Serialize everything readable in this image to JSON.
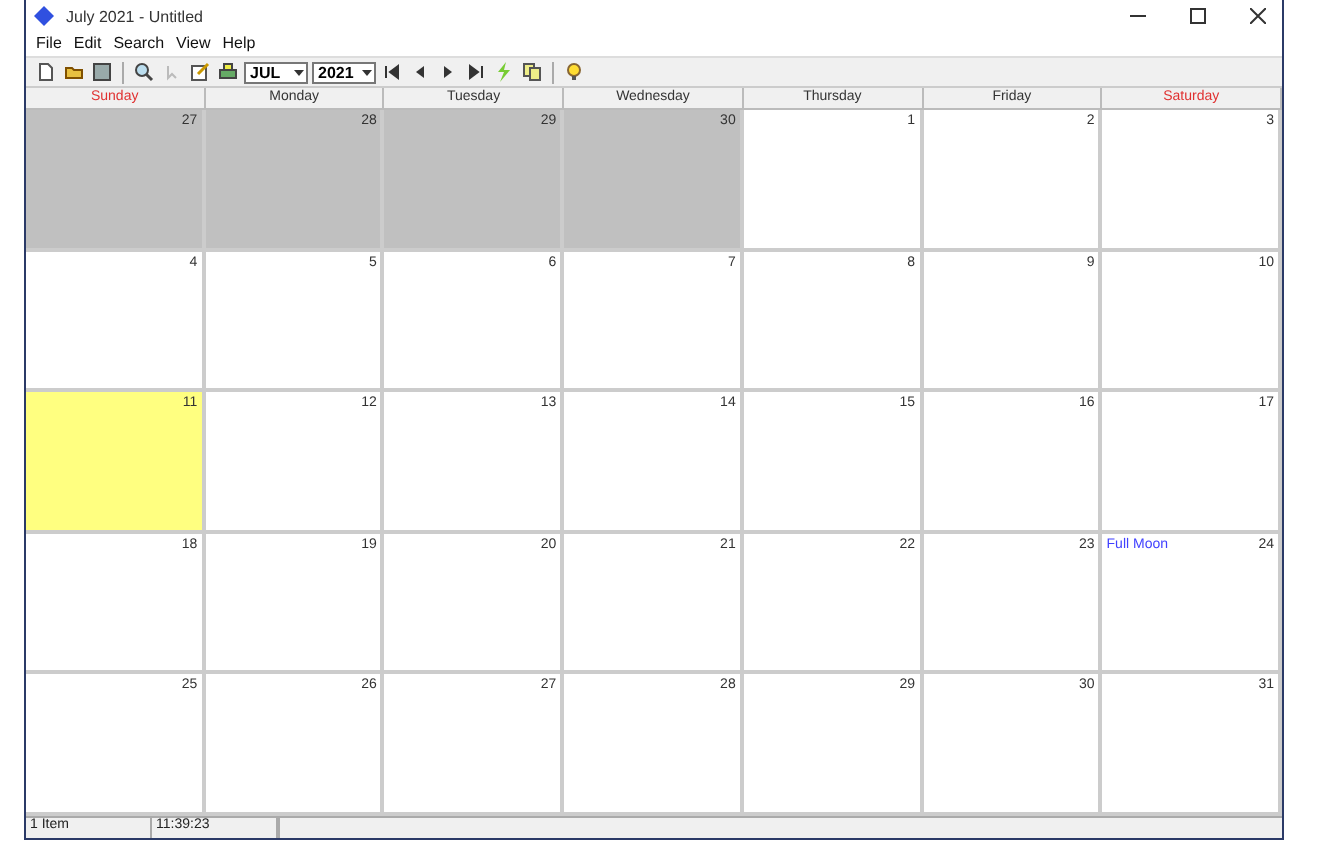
{
  "window": {
    "title": "July 2021 - Untitled"
  },
  "menu": [
    "File",
    "Edit",
    "Search",
    "View",
    "Help"
  ],
  "toolbar": {
    "month": "JUL",
    "year": "2021"
  },
  "weekdays": [
    {
      "label": "Sunday",
      "weekend": true
    },
    {
      "label": "Monday",
      "weekend": false
    },
    {
      "label": "Tuesday",
      "weekend": false
    },
    {
      "label": "Wednesday",
      "weekend": false
    },
    {
      "label": "Thursday",
      "weekend": false
    },
    {
      "label": "Friday",
      "weekend": false
    },
    {
      "label": "Saturday",
      "weekend": true
    }
  ],
  "weeks": [
    [
      {
        "day": "27",
        "kind": "other"
      },
      {
        "day": "28",
        "kind": "other"
      },
      {
        "day": "29",
        "kind": "other"
      },
      {
        "day": "30",
        "kind": "other"
      },
      {
        "day": "1",
        "kind": "normal"
      },
      {
        "day": "2",
        "kind": "normal"
      },
      {
        "day": "3",
        "kind": "normal"
      }
    ],
    [
      {
        "day": "4",
        "kind": "normal"
      },
      {
        "day": "5",
        "kind": "normal"
      },
      {
        "day": "6",
        "kind": "normal"
      },
      {
        "day": "7",
        "kind": "normal"
      },
      {
        "day": "8",
        "kind": "normal"
      },
      {
        "day": "9",
        "kind": "normal"
      },
      {
        "day": "10",
        "kind": "normal"
      }
    ],
    [
      {
        "day": "11",
        "kind": "today"
      },
      {
        "day": "12",
        "kind": "normal"
      },
      {
        "day": "13",
        "kind": "normal"
      },
      {
        "day": "14",
        "kind": "normal"
      },
      {
        "day": "15",
        "kind": "normal"
      },
      {
        "day": "16",
        "kind": "normal"
      },
      {
        "day": "17",
        "kind": "normal"
      }
    ],
    [
      {
        "day": "18",
        "kind": "normal"
      },
      {
        "day": "19",
        "kind": "normal"
      },
      {
        "day": "20",
        "kind": "normal"
      },
      {
        "day": "21",
        "kind": "normal"
      },
      {
        "day": "22",
        "kind": "normal"
      },
      {
        "day": "23",
        "kind": "normal"
      },
      {
        "day": "24",
        "kind": "normal",
        "event": "Full Moon"
      }
    ],
    [
      {
        "day": "25",
        "kind": "normal"
      },
      {
        "day": "26",
        "kind": "normal"
      },
      {
        "day": "27",
        "kind": "normal"
      },
      {
        "day": "28",
        "kind": "normal"
      },
      {
        "day": "29",
        "kind": "normal"
      },
      {
        "day": "30",
        "kind": "normal"
      },
      {
        "day": "31",
        "kind": "normal"
      }
    ]
  ],
  "status_bar": [
    "1 Item",
    "11:39:23"
  ]
}
